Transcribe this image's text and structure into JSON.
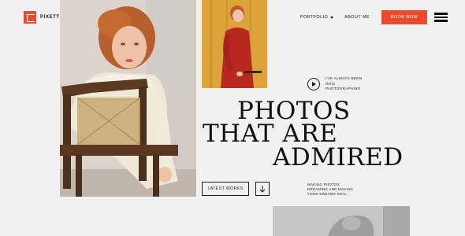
{
  "brand": {
    "name": "PIXETTY",
    "accent": "#ea4a2e"
  },
  "nav": {
    "portfolio_label": "PORTFOLIO",
    "about_label": "ABOUT ME",
    "book_label": "BOOK NOW"
  },
  "hero": {
    "video_caption": "I'VE ALWAYS BEEN INTO PHOTOGRAPHING",
    "headline_line1": "PHOTOS",
    "headline_line2": "THAT ARE",
    "headline_line3": "ADMIRED",
    "latest_works_label": "LATEST WORKS",
    "description": "MAKING PHOTOS DREAMING AND MAKING YOUR DREAMS REAL."
  },
  "icons": {
    "logo": "logo-mark-icon",
    "menu": "hamburger-menu-icon",
    "play": "play-icon",
    "arrow": "arrow-down-icon",
    "caret": "chevron-down-icon"
  }
}
